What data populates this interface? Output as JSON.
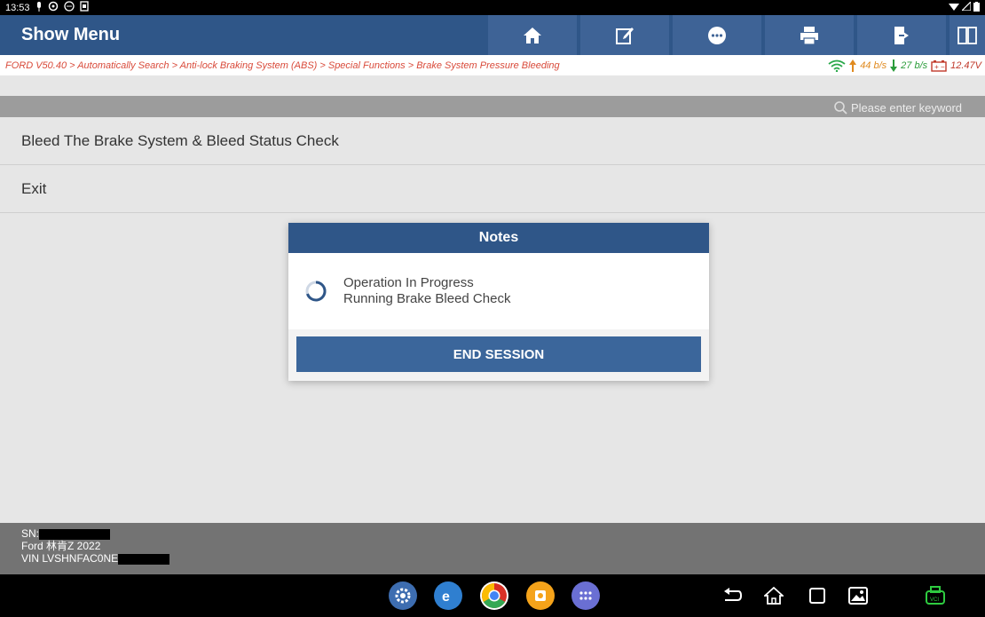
{
  "status_bar": {
    "time": "13:53"
  },
  "header": {
    "title": "Show Menu",
    "toolbar": [
      "home-icon",
      "edit-icon",
      "chat-icon",
      "print-icon",
      "exit-icon",
      "split-view-icon"
    ]
  },
  "breadcrumb": {
    "path": "FORD V50.40 > Automatically Search > Anti-lock Braking System (ABS) > Special Functions > Brake System Pressure Bleeding",
    "upload": "44 b/s",
    "download": "27 b/s",
    "voltage": "12.47V"
  },
  "search": {
    "placeholder": "Please enter keyword"
  },
  "menu": {
    "items": [
      {
        "label": "Bleed The Brake System & Bleed Status Check"
      },
      {
        "label": "Exit"
      }
    ]
  },
  "dialog": {
    "title": "Notes",
    "line1": "Operation In Progress",
    "line2": "Running Brake Bleed Check",
    "button": "END SESSION"
  },
  "footer": {
    "sn_label": "SN:",
    "vehicle": "Ford 林肯Z 2022",
    "vin_label": "VIN LVSHNFAC0NE"
  },
  "colors": {
    "header": "#2f5688",
    "breadcrumb": "#d94a3a",
    "button": "#3b669b"
  }
}
